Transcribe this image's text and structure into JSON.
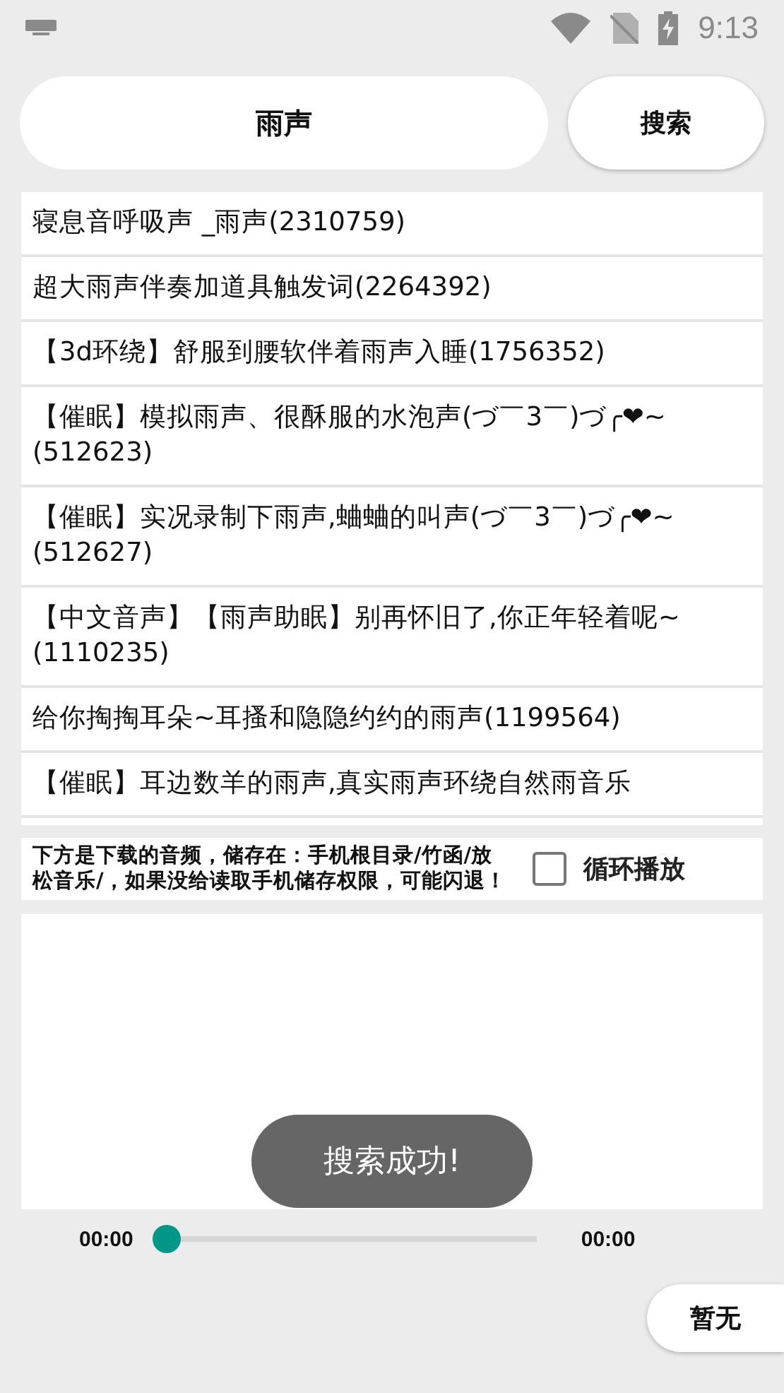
{
  "status_bar": {
    "time": "9:13"
  },
  "search": {
    "value": "雨声",
    "button": "搜索"
  },
  "results": [
    {
      "title": "寝息音呼吸声 _雨声(2310759)"
    },
    {
      "title": "超大雨声伴奏加道具触发词(2264392)"
    },
    {
      "title": "【3d环绕】舒服到腰软伴着雨声入睡(1756352)"
    },
    {
      "title": "【催眠】模拟雨声、很酥服的水泡声(づ￣3￣)づ╭❤~(512623)"
    },
    {
      "title": "【催眠】实况录制下雨声,蛐蛐的叫声(づ￣3￣)づ╭❤~(512627)"
    },
    {
      "title": "【中文音声】【雨声助眠】别再怀旧了,你正年轻着呢~(1110235)"
    },
    {
      "title": "给你掏掏耳朵~耳搔和隐隐约约的雨声(1199564)"
    },
    {
      "title": "【催眠】耳边数羊的雨声,真实雨声环绕自然雨音乐"
    }
  ],
  "notice": "下方是下载的音频，储存在：手机根目录/竹函/放松音乐/，如果没给读取手机储存权限，可能闪退！",
  "loop": {
    "label": "循环播放",
    "checked": false
  },
  "player": {
    "elapsed": "00:00",
    "total": "00:00",
    "level": 0,
    "button": "暂无"
  },
  "toast": "搜索成功!"
}
